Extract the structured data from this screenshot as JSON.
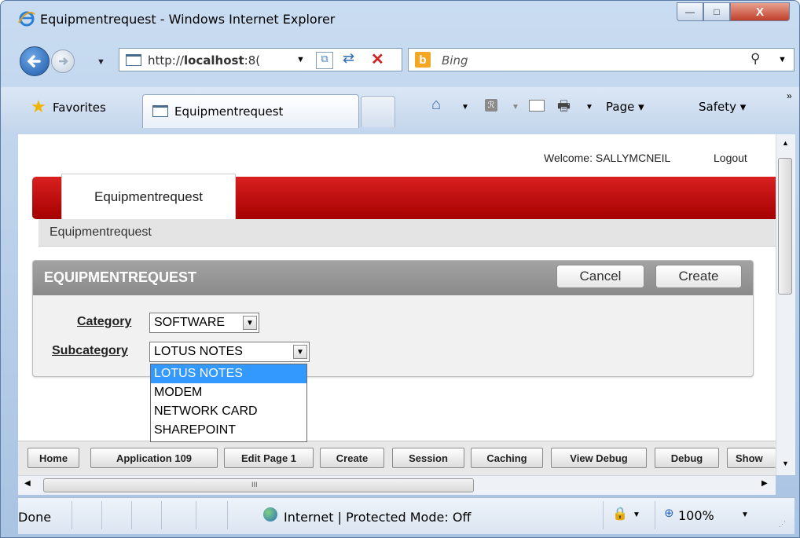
{
  "window": {
    "title": "Equipmentrequest - Windows Internet Explorer",
    "minimize_glyph": "—",
    "maximize_glyph": "□",
    "close_glyph": "X"
  },
  "navbar": {
    "address": "http://localhost:8(",
    "address_bold": "localhost",
    "search_placeholder": "Bing"
  },
  "tabs": {
    "favorites_label": "Favorites",
    "active_tab_label": "Equipmentrequest",
    "page_menu": "Page",
    "safety_menu": "Safety"
  },
  "apex": {
    "welcome_text": "Welcome: SALLYMCNEIL",
    "logout_label": "Logout",
    "tab_label": "Equipmentrequest",
    "breadcrumb": "Equipmentrequest",
    "region_title": "EQUIPMENTREQUEST",
    "cancel_label": "Cancel",
    "create_label": "Create",
    "category_label": "Category",
    "category_value": "SOFTWARE",
    "subcategory_label": "Subcategory",
    "subcategory_value": "LOTUS NOTES",
    "subcategory_options": [
      "LOTUS NOTES",
      "MODEM",
      "NETWORK CARD",
      "SHAREPOINT"
    ]
  },
  "devbar": {
    "buttons": [
      "Home",
      "Application 109",
      "Edit Page 1",
      "Create",
      "Session",
      "Caching",
      "View Debug",
      "Debug",
      "Show"
    ]
  },
  "hscroll": {
    "thumb_glyph": "III"
  },
  "status": {
    "text": "Done",
    "zone": "Internet | Protected Mode: Off",
    "zoom": "100%"
  },
  "colors": {
    "apex_red": "#c00000",
    "region_header": "#999999",
    "dropdown_highlight": "#3399ff",
    "ie_frame": "#b9d1ea"
  }
}
